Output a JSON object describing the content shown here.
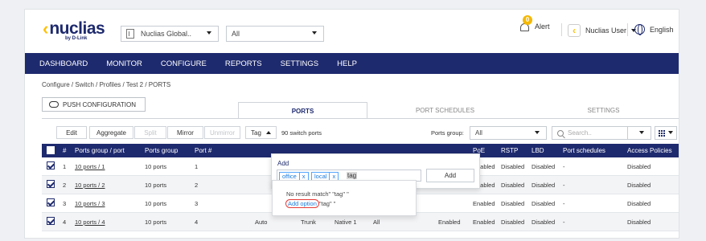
{
  "header": {
    "logo_text": "nuclias",
    "logo_sub": "by D-Link",
    "org_select": "Nuclias Global..",
    "site_select": "All",
    "alert_count": "0",
    "alert_label": "Alert",
    "user_label": "Nuclias User",
    "language_label": "English"
  },
  "nav": [
    "DASHBOARD",
    "MONITOR",
    "CONFIGURE",
    "REPORTS",
    "SETTINGS",
    "HELP"
  ],
  "breadcrumb": "Configure / Switch / Profiles / Test 2 / PORTS",
  "push_button": "PUSH CONFIGURATION",
  "tabs": [
    "PORTS",
    "PORT SCHEDULES",
    "SETTINGS"
  ],
  "toolbar": {
    "edit": "Edit",
    "aggregate": "Aggregate",
    "split": "Split",
    "mirror": "Mirror",
    "unmirror": "Unmirror",
    "tag": "Tag",
    "switch_count": "90 switch ports",
    "ports_group_label": "Ports group:",
    "ports_group_value": "All",
    "search_placeholder": "Search.."
  },
  "table": {
    "headers": [
      "#",
      "Ports group / port",
      "Ports group",
      "Port #",
      "PoE",
      "RSTP",
      "LBD",
      "Port schedules",
      "Access Policies"
    ],
    "rows": [
      {
        "num": "1",
        "port": "10 ports / 1",
        "group": "10 ports",
        "portnum": "1",
        "poe": "Enabled",
        "rstp": "Disabled",
        "lbd": "Disabled",
        "sched": "-",
        "access": "Disabled"
      },
      {
        "num": "2",
        "port": "10 ports / 2",
        "group": "10 ports",
        "portnum": "2",
        "poe": "Enabled",
        "rstp": "Disabled",
        "lbd": "Disabled",
        "sched": "-",
        "access": "Disabled"
      },
      {
        "num": "3",
        "port": "10 ports / 3",
        "group": "10 ports",
        "portnum": "3",
        "poe": "Enabled",
        "rstp": "Disabled",
        "lbd": "Disabled",
        "sched": "-",
        "access": "Disabled"
      },
      {
        "num": "4",
        "port": "10 ports / 4",
        "group": "10 ports",
        "portnum": "4",
        "speed": "Auto",
        "type": "Trunk",
        "native": "Native 1",
        "allowed": "All",
        "state": "Enabled",
        "poe": "Enabled",
        "rstp": "Disabled",
        "lbd": "Disabled",
        "sched": "-",
        "access": "Disabled"
      }
    ]
  },
  "popup": {
    "add_label": "Add",
    "chips": [
      "office",
      "local"
    ],
    "chip_remove": "x",
    "typed": "tag",
    "add_button": "Add",
    "no_result": "No result match\" \"tag\" \"",
    "add_option": "Add option",
    "add_option_suffix": "\"tag\" \""
  }
}
